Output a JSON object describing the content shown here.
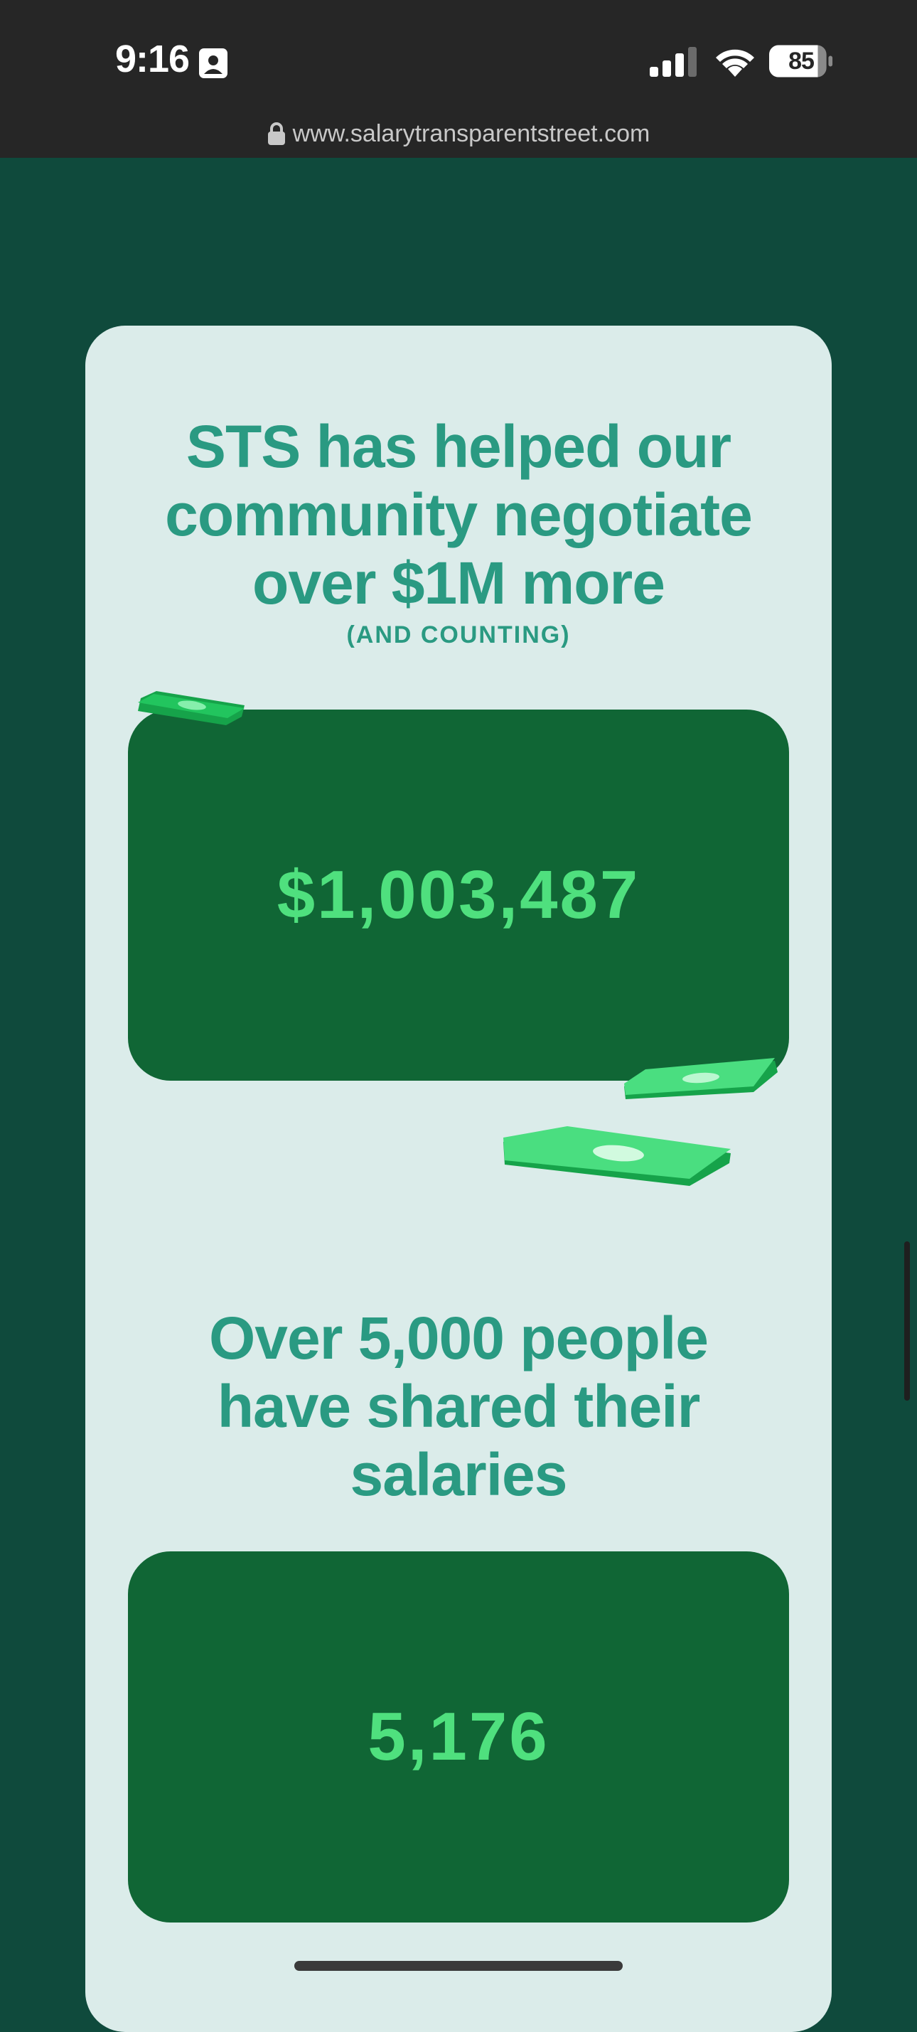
{
  "status_bar": {
    "time": "9:16",
    "battery_level": "85",
    "icons": [
      "contact-card-icon",
      "cellular-signal-icon",
      "wifi-icon",
      "battery-icon"
    ]
  },
  "browser": {
    "url": "www.salarytransparentstreet.com",
    "icons": [
      "lock-icon"
    ]
  },
  "stats": {
    "negotiated": {
      "heading_lines": [
        "STS has helped our",
        "community negotiate",
        "over $1M more"
      ],
      "subheading": "(AND COUNTING)",
      "value": "$1,003,487"
    },
    "shared": {
      "heading_lines": [
        "Over 5,000 people",
        "have shared their",
        "salaries"
      ],
      "value": "5,176"
    }
  },
  "colors": {
    "page_background": "#0f4a3c",
    "card_background": "#dbecea",
    "heading_text": "#2a9a82",
    "counter_box": "#106635",
    "counter_text": "#4fe07e",
    "status_bar": "#262626"
  },
  "decorations": [
    "money-bill-icon",
    "money-bill-icon",
    "money-bill-icon"
  ]
}
